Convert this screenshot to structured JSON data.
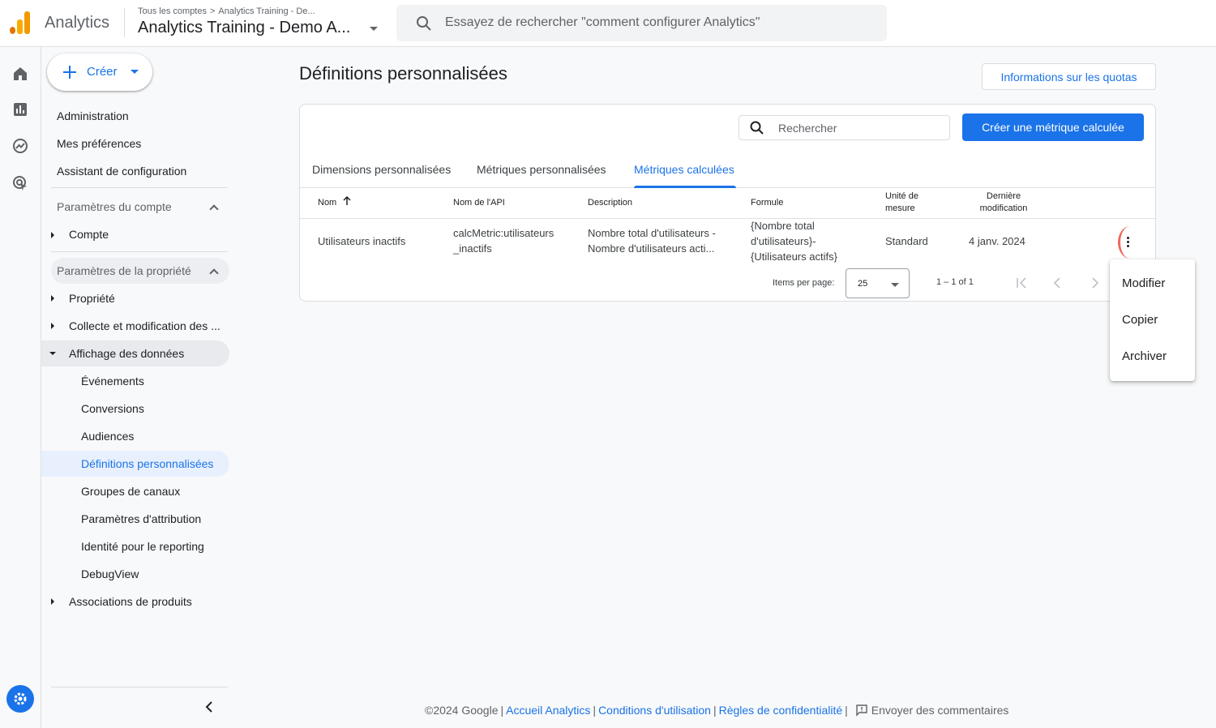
{
  "header": {
    "app_name": "Analytics",
    "breadcrumb": [
      "Tous les comptes",
      "Analytics Training - De..."
    ],
    "property_title": "Analytics Training - Demo A...",
    "search_placeholder": "Essayez de rechercher \"comment configurer Analytics\""
  },
  "rail": {
    "icons": [
      "home-icon",
      "reports-icon",
      "explore-icon",
      "advertising-icon"
    ],
    "settings_icon": "gear-icon"
  },
  "sidebar": {
    "create_label": "Créer",
    "top_items": [
      "Administration",
      "Mes préférences",
      "Assistant de configuration"
    ],
    "account_section": {
      "title": "Paramètres du compte",
      "items": [
        "Compte"
      ]
    },
    "property_section": {
      "title": "Paramètres de la propriété",
      "items": [
        "Propriété",
        "Collecte et modification des ...",
        "Affichage des données"
      ],
      "data_display_children": [
        "Événements",
        "Conversions",
        "Audiences",
        "Définitions personnalisées",
        "Groupes de canaux",
        "Paramètres d'attribution",
        "Identité pour le reporting",
        "DebugView"
      ],
      "last_item": "Associations de produits"
    }
  },
  "main": {
    "title": "Définitions personnalisées",
    "quota_button": "Informations sur les quotas",
    "search_placeholder": "Rechercher",
    "create_metric_button": "Créer une métrique calculée",
    "tabs": [
      "Dimensions personnalisées",
      "Métriques personnalisées",
      "Métriques calculées"
    ],
    "active_tab": "Métriques calculées",
    "table": {
      "headers": {
        "name": "Nom",
        "api_name": "Nom de l'API",
        "description": "Description",
        "formula": "Formule",
        "unit_line1": "Unité de",
        "unit_line2": "mesure",
        "modified_line1": "Dernière",
        "modified_line2": "modification"
      },
      "rows": [
        {
          "name": "Utilisateurs inactifs",
          "api_name_line1": "calcMetric:utilisateurs",
          "api_name_line2": "_inactifs",
          "description_line1": "Nombre total d'utilisateurs -",
          "description_line2": "Nombre d'utilisateurs acti...",
          "formula_line1": "{Nombre total",
          "formula_line2": "d'utilisateurs}-",
          "formula_line3": "{Utilisateurs actifs}",
          "unit": "Standard",
          "modified": "4 janv. 2024"
        }
      ]
    },
    "pagination": {
      "items_per_page_label": "Items per page:",
      "items_per_page_value": "25",
      "range": "1 – 1 of 1"
    }
  },
  "context_menu": {
    "items": [
      "Modifier",
      "Copier",
      "Archiver"
    ]
  },
  "footer": {
    "copyright": "©2024 Google",
    "links": [
      "Accueil Analytics",
      "Conditions d'utilisation",
      "Règles de confidentialité"
    ],
    "feedback": "Envoyer des commentaires"
  },
  "colors": {
    "accent": "#1a73e8",
    "kebab_highlight": "#ee675c"
  }
}
